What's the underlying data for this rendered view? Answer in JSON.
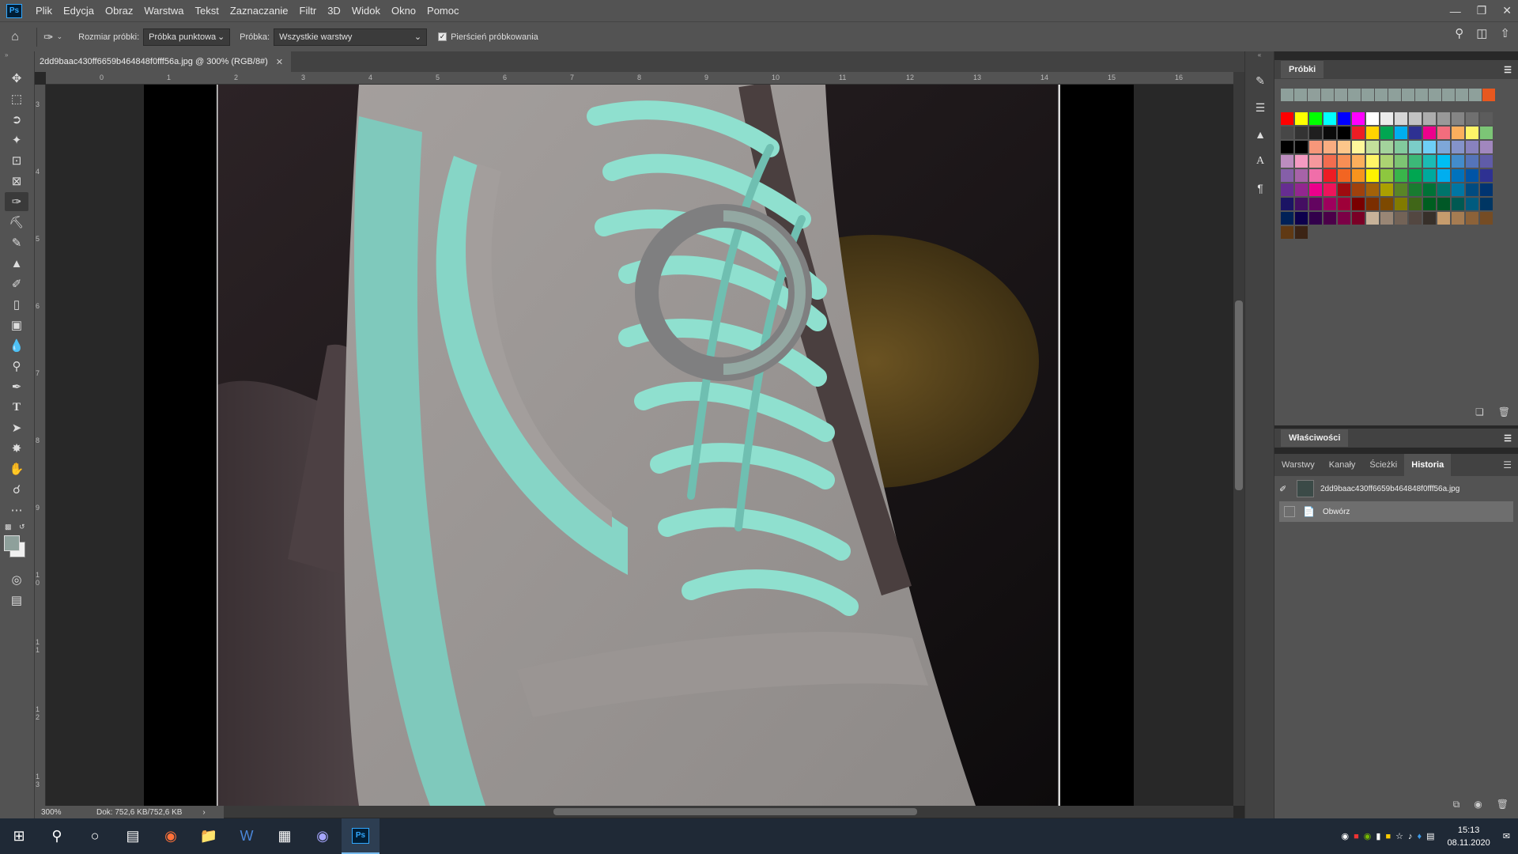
{
  "menu": [
    "Plik",
    "Edycja",
    "Obraz",
    "Warstwa",
    "Tekst",
    "Zaznaczanie",
    "Filtr",
    "3D",
    "Widok",
    "Okno",
    "Pomoc"
  ],
  "app_logo": "Ps",
  "options": {
    "sample_size_label": "Rozmiar próbki:",
    "sample_size_value": "Próbka punktowa",
    "sample_label": "Próbka:",
    "sample_value": "Wszystkie warstwy",
    "sampling_ring_label": "Pierścień próbkowania",
    "sampling_ring_checked": true
  },
  "document": {
    "tab_title": "2dd9baac430ff6659b464848f0fff56a.jpg @ 300% (RGB/8#)",
    "zoom": "300%",
    "doc_size": "Dok: 752,6 KB/752,6 KB"
  },
  "ruler": {
    "h_ticks": [
      "0",
      "1",
      "2",
      "3",
      "4",
      "5",
      "6",
      "7",
      "8",
      "9",
      "10",
      "11",
      "12",
      "13",
      "14",
      "15",
      "16"
    ],
    "v_ticks": [
      "3",
      "4",
      "5",
      "6",
      "7",
      "8",
      "9",
      "1\n0",
      "1\n1",
      "1\n2",
      "1\n3"
    ]
  },
  "panels": {
    "swatches_title": "Próbki",
    "properties_title": "Właściwości",
    "tabs": [
      "Warstwy",
      "Kanały",
      "Ścieżki",
      "Historia"
    ],
    "active_tab": "Historia",
    "history": [
      {
        "label": "2dd9baac430ff6659b464848f0fff56a.jpg",
        "kind": "snapshot"
      },
      {
        "label": "Obwórz",
        "kind": "step"
      }
    ]
  },
  "sampling_ring": {
    "outer_color": "#7f7f80",
    "inner_color": "#93a8a2"
  },
  "taskbar": {
    "time": "15:13",
    "date": "08.11.2020"
  },
  "swatch_colors": [
    [
      "#ff0000",
      "#ffff00",
      "#00ff00",
      "#00ffff",
      "#0000ff",
      "#ff00ff",
      "#ffffff",
      "#ebebeb",
      "#d6d6d6",
      "#c2c2c2",
      "#adadad",
      "#999999",
      "#858585",
      "#707070",
      "#5c5c5c"
    ],
    [
      "#474747",
      "#333333",
      "#1f1f1f",
      "#0a0a0a",
      "#000000",
      "#ed1c24",
      "#ffd400",
      "#00a651",
      "#00aeef",
      "#2e3192",
      "#ec008c",
      "#f26d7d",
      "#fbaf5d",
      "#fff568",
      "#7cc576"
    ],
    [
      "#000000",
      "#000000",
      "#f7977a",
      "#f9ad81",
      "#fdc68a",
      "#fff79a",
      "#c4df9b",
      "#a3d39c",
      "#82ca9d",
      "#7bcdc8",
      "#6ecff6",
      "#7ea7d8",
      "#8493ca",
      "#8882be",
      "#a187be"
    ],
    [
      "#bc8dbf",
      "#f49ac2",
      "#f6989d",
      "#f26c4f",
      "#f68e55",
      "#fbaf5c",
      "#fff467",
      "#acd372",
      "#7dc473",
      "#3cb878",
      "#1cbbb4",
      "#00bff3",
      "#438ccb",
      "#5574b9",
      "#605ca8"
    ],
    [
      "#855fa8",
      "#a763a8",
      "#f06ea9",
      "#ed1c24",
      "#f26522",
      "#f7941d",
      "#fff200",
      "#8dc73f",
      "#39b54a",
      "#00a651",
      "#00a99d",
      "#00aeef",
      "#0072bc",
      "#0054a6",
      "#2e3192"
    ],
    [
      "#662d91",
      "#92278f",
      "#ec008c",
      "#ed145b",
      "#9e0b0f",
      "#a0410d",
      "#a36209",
      "#aba000",
      "#598527",
      "#197b30",
      "#007236",
      "#00746b",
      "#0076a3",
      "#004b80",
      "#003471"
    ],
    [
      "#1b1464",
      "#440e62",
      "#630460",
      "#9e005d",
      "#9e0039",
      "#790000",
      "#7b2e00",
      "#7d4900",
      "#827b00",
      "#406618",
      "#005e20",
      "#005826",
      "#005952",
      "#005b7f",
      "#003663"
    ],
    [
      "#002157",
      "#0d004c",
      "#32004b",
      "#4b0049",
      "#7b0046",
      "#7a0026",
      "#c7b299",
      "#998675",
      "#736357",
      "#534741",
      "#37302a",
      "#c69c6d",
      "#a67c52",
      "#8c6239",
      "#754c24"
    ],
    [
      "#603913",
      "#3c2415"
    ]
  ]
}
